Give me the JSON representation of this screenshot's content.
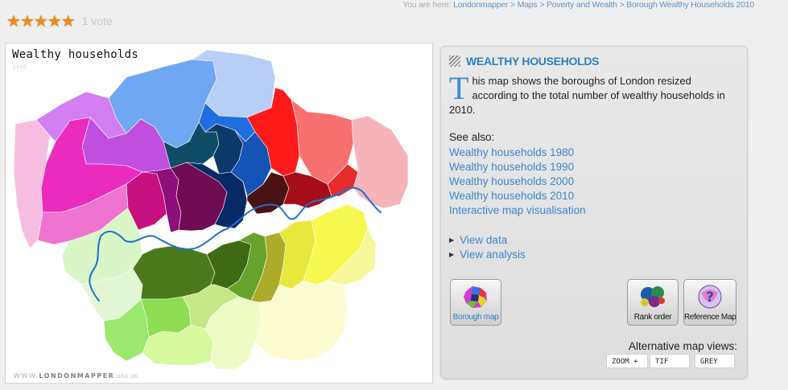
{
  "rating": {
    "stars": 5,
    "votes_label": "1 vote"
  },
  "breadcrumb": {
    "label": "You are here:",
    "items": [
      "Londonmapper",
      "Maps",
      "Poverty and Wealth",
      "Borough Wealthy Households 2010"
    ],
    "separator": ">"
  },
  "map": {
    "title": "Wealthy households",
    "year": "2010",
    "brand_prefix": "WWW.",
    "brand_name": "LONDONMAPPER",
    "brand_suffix": ".ORG.UK",
    "river_color": "#1e6fd0"
  },
  "info": {
    "heading": "WEALTHY HOUSEHOLDS",
    "intro_dropcap": "T",
    "intro_rest": "his map shows the boroughs of London resized according to the total number of wealthy households in 2010.",
    "see_also_label": "See also:",
    "see_also": [
      "Wealthy households 1980",
      "Wealthy households 1990",
      "Wealthy households 2000",
      "Wealthy households 2010",
      "Interactive map visualisation"
    ],
    "view_links": [
      "View data",
      "View analysis"
    ],
    "buttons": {
      "borough": "Borough map",
      "rank": "Rank order",
      "reference": "Reference Map"
    },
    "alt_views_label": "Alternative map views:",
    "alt_views": [
      "ZOOM +",
      "TIF",
      "GREY"
    ]
  },
  "icons": {
    "star": "star-icon",
    "bullet": "triangle-right-icon",
    "borough_map": "borough-map-icon",
    "rank_order": "rank-order-icon",
    "reference": "reference-map-icon"
  }
}
